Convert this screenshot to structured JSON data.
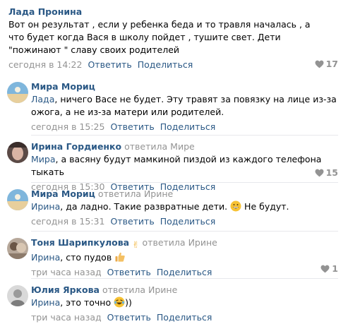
{
  "comments": [
    {
      "author": "Лада Пронина",
      "text": "Вот он результат , если у ребенка беда и то травля началась , а что будет когда Вася в школу пойдет , тушите свет. Дети \"пожинают \" славу своих родителей",
      "time": "сегодня в 14:22",
      "reply_label": "Ответить",
      "share_label": "Поделиться",
      "likes": "17"
    },
    {
      "author": "Мира Мориц",
      "mention": "Лада",
      "text_line1": ", ничего Васе не будет. Эту травят за повязку на лице из-за",
      "text_line2": "ожога, а не из-за матери или родителей.",
      "time": "сегодня в 15:25",
      "reply_label": "Ответить",
      "share_label": "Поделиться"
    },
    {
      "author": "Ирина Гордиенко",
      "replied_label": "ответила",
      "reply_to": "Мире",
      "mention": "Мира",
      "text": ", а васяну будут мамкиной пиздой из каждого телефона тыкать",
      "time": "сегодня в 15:30",
      "reply_label": "Ответить",
      "share_label": "Поделиться",
      "likes": "15"
    },
    {
      "author": "Мира Мориц",
      "replied_label": "ответила",
      "reply_to": "Ирине",
      "mention": "Ирина",
      "text": ", да ладно. Такие развратные дети.",
      "text_after": "Не будут.",
      "time": "сегодня в 15:31",
      "reply_label": "Ответить",
      "share_label": "Поделиться"
    },
    {
      "author": "Тоня Шарипкулова",
      "replied_label": "ответила",
      "reply_to": "Ирине",
      "mention": "Ирина",
      "text": ", сто пудов",
      "time": "три часа назад",
      "reply_label": "Ответить",
      "share_label": "Поделиться",
      "likes": "1"
    },
    {
      "author": "Юлия Яркова",
      "replied_label": "ответила",
      "reply_to": "Ирине",
      "mention": "Ирина",
      "text": ", это точно",
      "text_after": "))",
      "time": "три часа назад",
      "reply_label": "Ответить",
      "share_label": "Поделиться"
    }
  ],
  "colors": {
    "link": "#2a5885",
    "meta": "#939393",
    "separator": "#e7e8ec"
  },
  "icons": [
    "heart-icon",
    "victory-hand-emoji",
    "grinning-emoji",
    "thumbs-up-emoji",
    "laughing-tears-emoji"
  ]
}
